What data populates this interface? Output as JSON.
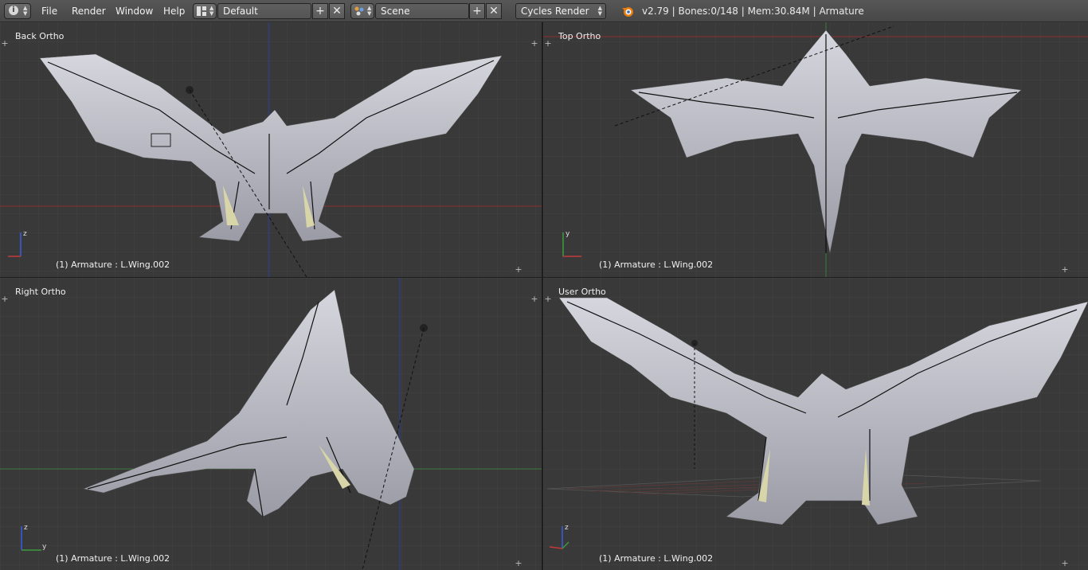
{
  "topbar": {
    "info_icon": "info-icon",
    "menus": [
      "File",
      "Render",
      "Window",
      "Help"
    ],
    "layout": {
      "icon": "screen-layout-icon",
      "value": "Default"
    },
    "scene": {
      "icon": "scene-icon",
      "value": "Scene"
    },
    "render_engine": "Cycles Render",
    "blender_icon": "blender-logo-icon",
    "status": "v2.79 | Bones:0/148  | Mem:30.84M | Armature"
  },
  "viewports": [
    {
      "label": "Back Ortho",
      "status": "(1) Armature : L.Wing.002"
    },
    {
      "label": "Top Ortho",
      "status": "(1) Armature : L.Wing.002"
    },
    {
      "label": "Right Ortho",
      "status": "(1) Armature : L.Wing.002"
    },
    {
      "label": "User Ortho",
      "status": "(1) Armature : L.Wing.002"
    }
  ],
  "axis_labels": {
    "z": "z",
    "y": "y"
  },
  "colors": {
    "viewport_bg": "#393939",
    "grid": "#444444",
    "x_axis": "#8b2f2f",
    "y_axis": "#3d7a3d",
    "z_axis": "#2d3da0",
    "model": "#b9b9c4"
  }
}
